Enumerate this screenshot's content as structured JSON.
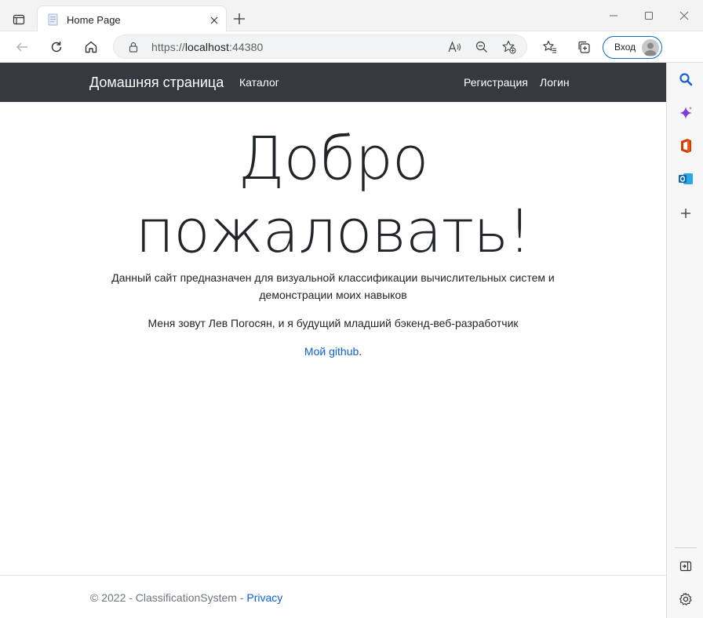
{
  "browser": {
    "tab": {
      "title": "Home Page"
    },
    "address": {
      "scheme": "https://",
      "host": "localhost",
      "port": ":44380"
    },
    "signin_label": "Вход"
  },
  "site": {
    "brand": "Домашняя страница",
    "nav": {
      "catalog": "Каталог",
      "register": "Регистрация",
      "login": "Логин"
    },
    "hero": {
      "line1": "Добро",
      "line2": "пожаловать!"
    },
    "description": {
      "line1": "Данный сайт предназначен для визуальной классификации вычислительных систем и",
      "line2": "демонстрации моих навыков"
    },
    "intro": "Меня зовут Лев Погосян, и я будущий младший бэкенд-веб-разработчик",
    "github_link": "Мой github",
    "github_period": ".",
    "footer": {
      "copyright": "© 2022 - ClassificationSystem - ",
      "privacy": "Privacy"
    }
  },
  "colors": {
    "navbar": "#343a40",
    "link": "#0b5ed7",
    "signin_border": "#0f6cbd"
  }
}
